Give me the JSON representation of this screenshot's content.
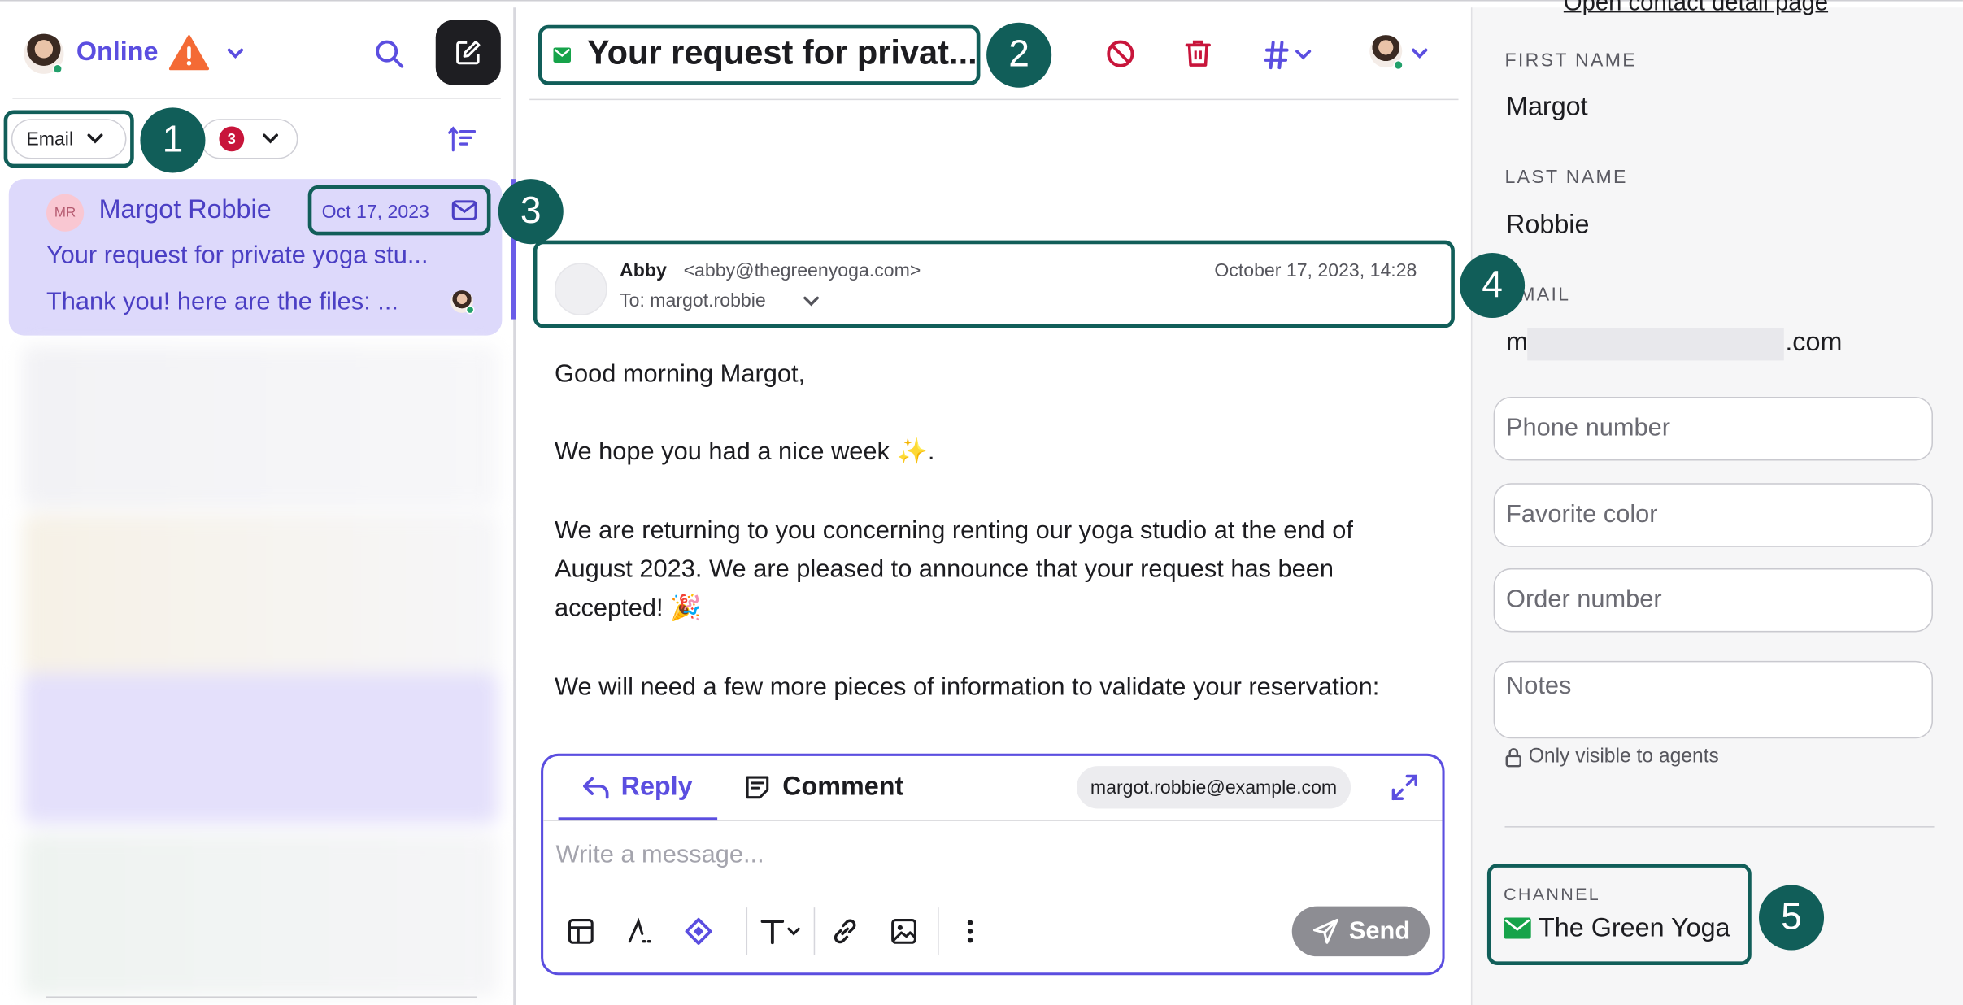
{
  "status": {
    "label": "Online"
  },
  "filters": {
    "channel_label": "Email",
    "badge_count": "3"
  },
  "conversation": {
    "initials": "MR",
    "name": "Margot Robbie",
    "date": "Oct 17, 2023",
    "subject": "Your request for private yoga stu...",
    "preview": "Thank you! here are the files: ..."
  },
  "thread": {
    "title": "Your request for privat...",
    "sender_name": "Abby",
    "sender_email": "<abby@thegreenyoga.com>",
    "to": "To: margot.robbie",
    "date": "October 17, 2023, 14:28",
    "body": [
      "Good morning Margot,",
      "We hope you had a nice week ✨.",
      "We are returning to you concerning renting our yoga studio at the end of August 2023. We are pleased to announce that your request has been accepted! 🎉",
      "We will need a few more pieces of information to validate your reservation:"
    ]
  },
  "composer": {
    "reply_tab": "Reply",
    "comment_tab": "Comment",
    "recipient": "margot.robbie@example.com",
    "placeholder": "Write a message...",
    "send_label": "Send"
  },
  "contact": {
    "detail_link": "Open contact detail page",
    "first_name_label": "FIRST NAME",
    "first_name": "Margot",
    "last_name_label": "LAST NAME",
    "last_name": "Robbie",
    "email_label": "EMAIL",
    "email_prefix": "m",
    "email_suffix": ".com",
    "phone_placeholder": "Phone number",
    "color_placeholder": "Favorite color",
    "order_placeholder": "Order number",
    "notes_placeholder": "Notes",
    "visibility_note": "Only visible to agents",
    "channel_label": "CHANNEL",
    "channel_name": "The Green Yoga"
  },
  "callouts": [
    "1",
    "2",
    "3",
    "4",
    "5"
  ],
  "colors": {
    "accent": "#5b4ee0",
    "callout": "#115e59",
    "danger": "#c8153b",
    "selected": "#ddd9fb"
  }
}
